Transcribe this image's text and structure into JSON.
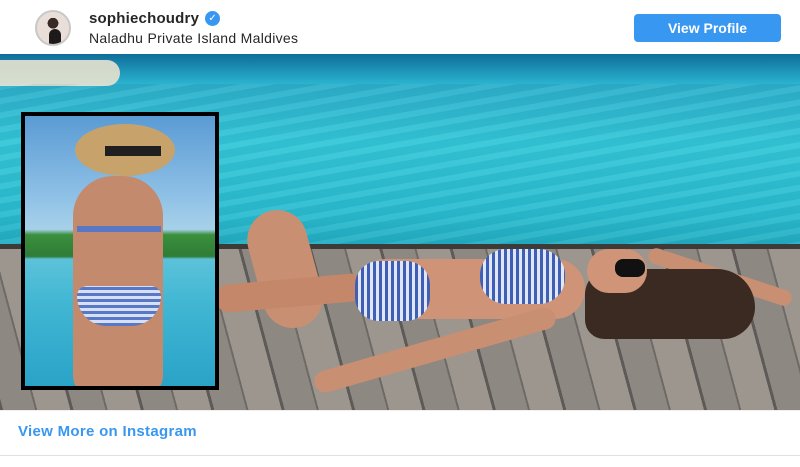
{
  "header": {
    "username": "sophiechoudry",
    "verified_icon": "check-badge-icon",
    "location": "Naladhu Private Island Maldives",
    "view_profile_label": "View Profile"
  },
  "footer": {
    "view_more_label": "View More on Instagram"
  },
  "colors": {
    "accent": "#3897f0",
    "text": "#262626"
  }
}
